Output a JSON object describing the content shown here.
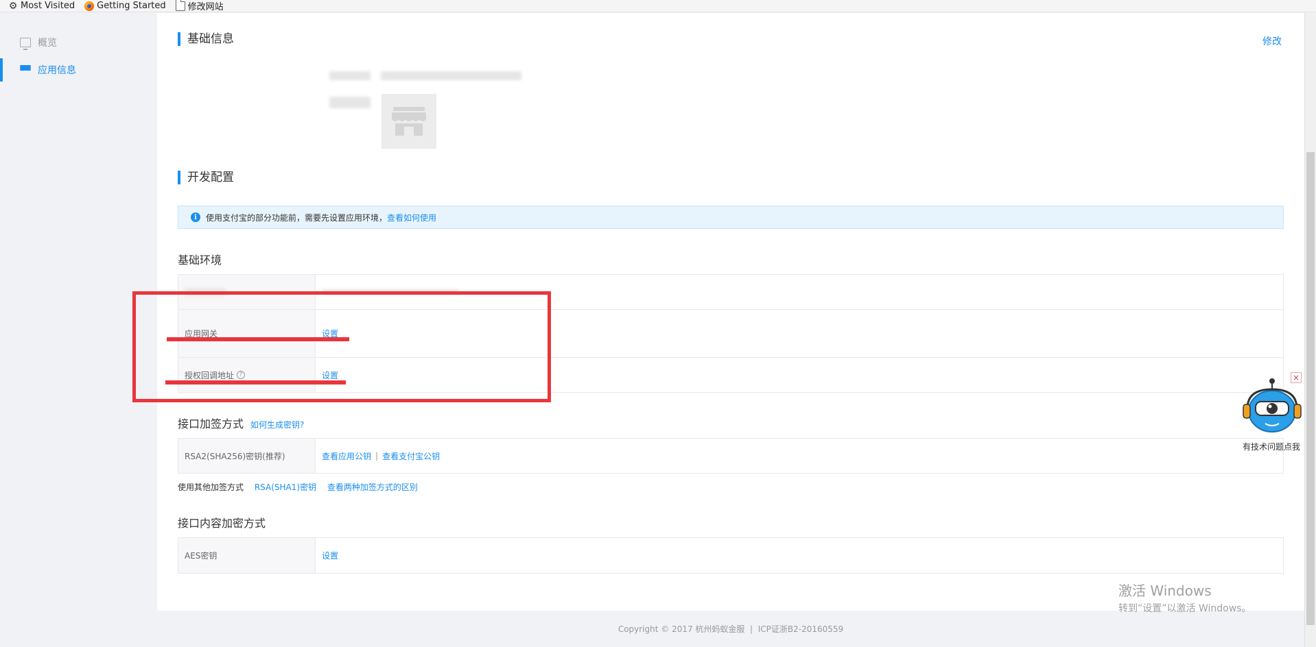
{
  "bookmarks": [
    {
      "label": "Most Visited",
      "icon": "gear-icon"
    },
    {
      "label": "Getting Started",
      "icon": "firefox-icon"
    },
    {
      "label": "修改网站",
      "icon": "folder-icon"
    }
  ],
  "sidebar": {
    "items": [
      {
        "label": "概览",
        "icon": "monitor-icon",
        "active": false
      },
      {
        "label": "应用信息",
        "icon": "apps-grid-icon",
        "active": true
      }
    ]
  },
  "basic_info": {
    "title": "基础信息",
    "edit_label": "修改"
  },
  "dev_config": {
    "title": "开发配置",
    "notice": {
      "text": "使用支付宝的部分功能前，需要先设置应用环境，",
      "link": "查看如何使用"
    },
    "basic_env": {
      "title": "基础环境",
      "rows": [
        {
          "label": "",
          "value": ""
        },
        {
          "label": "应用网关",
          "value": "设置"
        },
        {
          "label": "授权回调地址",
          "value": "设置"
        }
      ]
    },
    "signing": {
      "title": "接口加签方式",
      "help_link": "如何生成密钥?",
      "row_label": "RSA2(SHA256)密钥(推荐)",
      "app_key_link": "查看应用公钥",
      "alipay_key_link": "查看支付宝公钥",
      "separator": "|",
      "other_label": "使用其他加签方式",
      "rsa1_link": "RSA(SHA1)密钥",
      "diff_link": "查看两种加签方式的区别"
    },
    "encryption": {
      "title": "接口内容加密方式",
      "row_label": "AES密钥",
      "value": "设置"
    }
  },
  "footer": {
    "text": "Copyright © 2017 杭州蚂蚁金服  |  ICP证浙B2-20160559"
  },
  "watermark": {
    "line1": "激活 Windows",
    "line2": "转到“设置”以激活 Windows。"
  },
  "support": {
    "label": "有技术问题点我",
    "close": "×"
  },
  "colors": {
    "accent": "#1a8ef0",
    "annotation": "#e8363d"
  }
}
